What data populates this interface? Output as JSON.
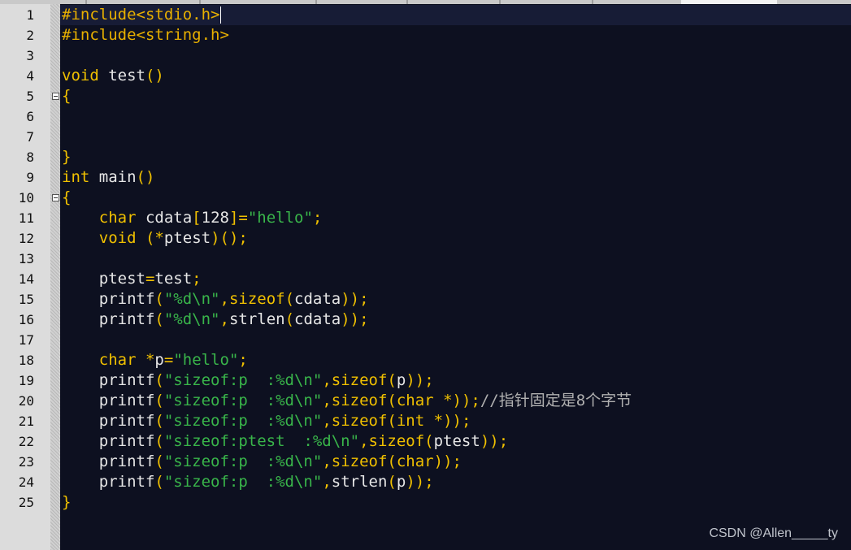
{
  "colors": {
    "background": "#0d1020",
    "current_line": "#171c36",
    "preprocessor": "#e8b000",
    "keyword": "#f0c000",
    "identifier": "#e6e6e6",
    "operator": "#f0c000",
    "number": "#e6e6e6",
    "string": "#39b54a",
    "comment": "#b0b0b0"
  },
  "editor": {
    "current_line": 1,
    "caret_line": 1,
    "fold_markers": [
      5,
      10
    ],
    "lines": [
      {
        "n": "1",
        "tokens": [
          [
            "#include<stdio.h>",
            "pre"
          ]
        ]
      },
      {
        "n": "2",
        "tokens": [
          [
            "#include<string.h>",
            "pre"
          ]
        ]
      },
      {
        "n": "3",
        "tokens": []
      },
      {
        "n": "4",
        "tokens": [
          [
            "void",
            "kw"
          ],
          [
            " test",
            "id"
          ],
          [
            "()",
            "op"
          ]
        ]
      },
      {
        "n": "5",
        "tokens": [
          [
            "{",
            "op"
          ]
        ]
      },
      {
        "n": "6",
        "tokens": []
      },
      {
        "n": "7",
        "tokens": []
      },
      {
        "n": "8",
        "tokens": [
          [
            "}",
            "op"
          ]
        ]
      },
      {
        "n": "9",
        "tokens": [
          [
            "int",
            "kw"
          ],
          [
            " main",
            "id"
          ],
          [
            "()",
            "op"
          ]
        ]
      },
      {
        "n": "10",
        "tokens": [
          [
            "{",
            "op"
          ]
        ]
      },
      {
        "n": "11",
        "tokens": [
          [
            "    ",
            "id"
          ],
          [
            "char",
            "kw"
          ],
          [
            " cdata",
            "id"
          ],
          [
            "[",
            "op"
          ],
          [
            "128",
            "num"
          ],
          [
            "]=",
            "op"
          ],
          [
            "\"hello\"",
            "str"
          ],
          [
            ";",
            "op"
          ]
        ]
      },
      {
        "n": "12",
        "tokens": [
          [
            "    ",
            "id"
          ],
          [
            "void",
            "kw"
          ],
          [
            " (",
            "op"
          ],
          [
            "*",
            "op"
          ],
          [
            "ptest",
            "id"
          ],
          [
            ")();",
            "op"
          ]
        ]
      },
      {
        "n": "13",
        "tokens": []
      },
      {
        "n": "14",
        "tokens": [
          [
            "    ptest",
            "id"
          ],
          [
            "=",
            "op"
          ],
          [
            "test",
            "id"
          ],
          [
            ";",
            "op"
          ]
        ]
      },
      {
        "n": "15",
        "tokens": [
          [
            "    printf",
            "id"
          ],
          [
            "(",
            "op"
          ],
          [
            "\"%d\\n\"",
            "str"
          ],
          [
            ",",
            "op"
          ],
          [
            "sizeof",
            "kw"
          ],
          [
            "(",
            "op"
          ],
          [
            "cdata",
            "id"
          ],
          [
            "));",
            "op"
          ]
        ]
      },
      {
        "n": "16",
        "tokens": [
          [
            "    printf",
            "id"
          ],
          [
            "(",
            "op"
          ],
          [
            "\"%d\\n\"",
            "str"
          ],
          [
            ",",
            "op"
          ],
          [
            "strlen",
            "id"
          ],
          [
            "(",
            "op"
          ],
          [
            "cdata",
            "id"
          ],
          [
            "));",
            "op"
          ]
        ]
      },
      {
        "n": "17",
        "tokens": []
      },
      {
        "n": "18",
        "tokens": [
          [
            "    ",
            "id"
          ],
          [
            "char",
            "kw"
          ],
          [
            " *",
            "op"
          ],
          [
            "p",
            "id"
          ],
          [
            "=",
            "op"
          ],
          [
            "\"hello\"",
            "str"
          ],
          [
            ";",
            "op"
          ]
        ]
      },
      {
        "n": "19",
        "tokens": [
          [
            "    printf",
            "id"
          ],
          [
            "(",
            "op"
          ],
          [
            "\"sizeof:p  :%d\\n\"",
            "str"
          ],
          [
            ",",
            "op"
          ],
          [
            "sizeof",
            "kw"
          ],
          [
            "(",
            "op"
          ],
          [
            "p",
            "id"
          ],
          [
            "));",
            "op"
          ]
        ]
      },
      {
        "n": "20",
        "tokens": [
          [
            "    printf",
            "id"
          ],
          [
            "(",
            "op"
          ],
          [
            "\"sizeof:p  :%d\\n\"",
            "str"
          ],
          [
            ",",
            "op"
          ],
          [
            "sizeof",
            "kw"
          ],
          [
            "(",
            "op"
          ],
          [
            "char",
            "kw"
          ],
          [
            " *",
            "op"
          ],
          [
            "));",
            "op"
          ],
          [
            "//指针固定是8个字节",
            "cmt"
          ]
        ]
      },
      {
        "n": "21",
        "tokens": [
          [
            "    printf",
            "id"
          ],
          [
            "(",
            "op"
          ],
          [
            "\"sizeof:p  :%d\\n\"",
            "str"
          ],
          [
            ",",
            "op"
          ],
          [
            "sizeof",
            "kw"
          ],
          [
            "(",
            "op"
          ],
          [
            "int",
            "kw"
          ],
          [
            " *",
            "op"
          ],
          [
            "));",
            "op"
          ]
        ]
      },
      {
        "n": "22",
        "tokens": [
          [
            "    printf",
            "id"
          ],
          [
            "(",
            "op"
          ],
          [
            "\"sizeof:ptest  :%d\\n\"",
            "str"
          ],
          [
            ",",
            "op"
          ],
          [
            "sizeof",
            "kw"
          ],
          [
            "(",
            "op"
          ],
          [
            "ptest",
            "id"
          ],
          [
            "));",
            "op"
          ]
        ]
      },
      {
        "n": "23",
        "tokens": [
          [
            "    printf",
            "id"
          ],
          [
            "(",
            "op"
          ],
          [
            "\"sizeof:p  :%d\\n\"",
            "str"
          ],
          [
            ",",
            "op"
          ],
          [
            "sizeof",
            "kw"
          ],
          [
            "(",
            "op"
          ],
          [
            "char",
            "kw"
          ],
          [
            "));",
            "op"
          ]
        ]
      },
      {
        "n": "24",
        "tokens": [
          [
            "    printf",
            "id"
          ],
          [
            "(",
            "op"
          ],
          [
            "\"sizeof:p  :%d\\n\"",
            "str"
          ],
          [
            ",",
            "op"
          ],
          [
            "strlen",
            "id"
          ],
          [
            "(",
            "op"
          ],
          [
            "p",
            "id"
          ],
          [
            "));",
            "op"
          ]
        ]
      },
      {
        "n": "25",
        "tokens": [
          [
            "}",
            "op"
          ]
        ]
      }
    ]
  },
  "watermark": "CSDN @Allen_____ty"
}
